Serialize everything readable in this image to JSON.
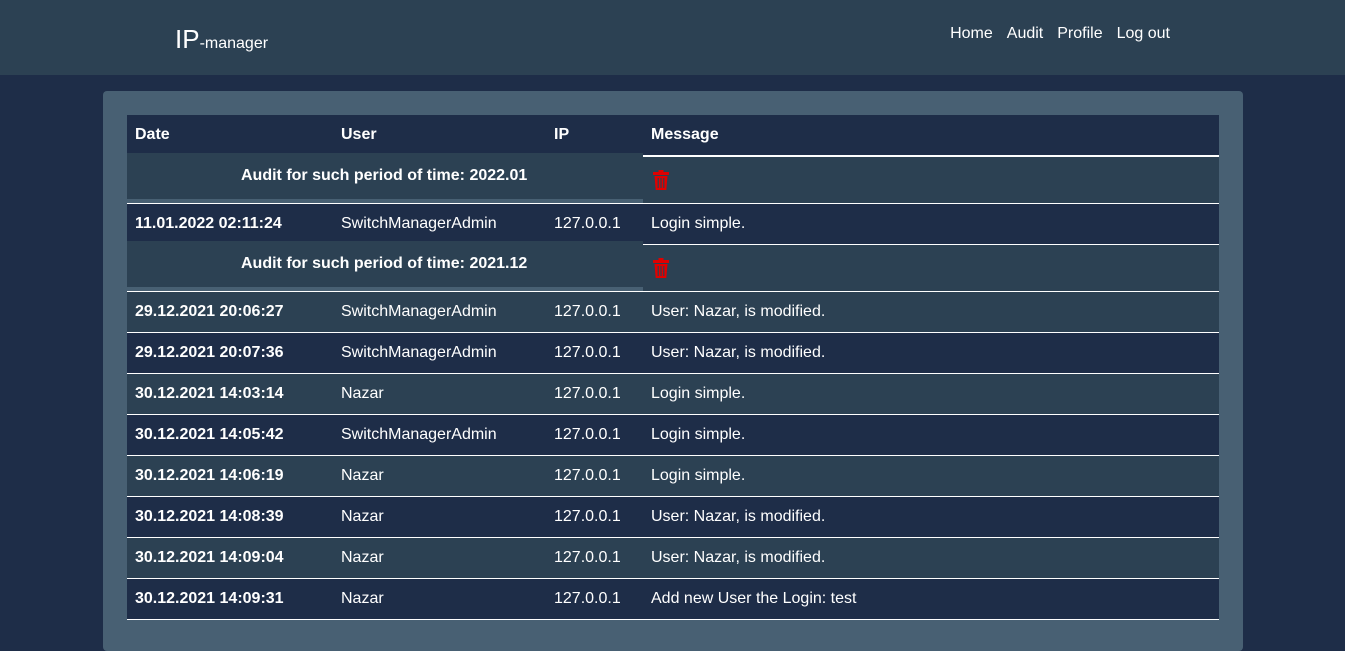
{
  "brand": {
    "main": "IP",
    "suffix": "-manager"
  },
  "nav": {
    "home": "Home",
    "audit": "Audit",
    "profile": "Profile",
    "logout": "Log out"
  },
  "table": {
    "headers": {
      "date": "Date",
      "user": "User",
      "ip": "IP",
      "message": "Message"
    },
    "groups": [
      {
        "label": "Audit for such period of time: 2022.01",
        "rows": [
          {
            "date": "11.01.2022 02:11:24",
            "user": "SwitchManagerAdmin",
            "ip": "127.0.0.1",
            "message": "Login simple."
          }
        ]
      },
      {
        "label": "Audit for such period of time: 2021.12",
        "rows": [
          {
            "date": "29.12.2021 20:06:27",
            "user": "SwitchManagerAdmin",
            "ip": "127.0.0.1",
            "message": "User: Nazar, is modified."
          },
          {
            "date": "29.12.2021 20:07:36",
            "user": "SwitchManagerAdmin",
            "ip": "127.0.0.1",
            "message": "User: Nazar, is modified."
          },
          {
            "date": "30.12.2021 14:03:14",
            "user": "Nazar",
            "ip": "127.0.0.1",
            "message": "Login simple."
          },
          {
            "date": "30.12.2021 14:05:42",
            "user": "SwitchManagerAdmin",
            "ip": "127.0.0.1",
            "message": "Login simple."
          },
          {
            "date": "30.12.2021 14:06:19",
            "user": "Nazar",
            "ip": "127.0.0.1",
            "message": "Login simple."
          },
          {
            "date": "30.12.2021 14:08:39",
            "user": "Nazar",
            "ip": "127.0.0.1",
            "message": "User: Nazar, is modified."
          },
          {
            "date": "30.12.2021 14:09:04",
            "user": "Nazar",
            "ip": "127.0.0.1",
            "message": "User: Nazar, is modified."
          },
          {
            "date": "30.12.2021 14:09:31",
            "user": "Nazar",
            "ip": "127.0.0.1",
            "message": "Add new User the Login: test"
          }
        ]
      }
    ]
  },
  "icons": {
    "delete": "trash-icon"
  },
  "colors": {
    "background": "#1e2d48",
    "topbar": "#2c4153",
    "panel": "#486073",
    "row_light": "#2c4153",
    "trash": "#e00000"
  }
}
